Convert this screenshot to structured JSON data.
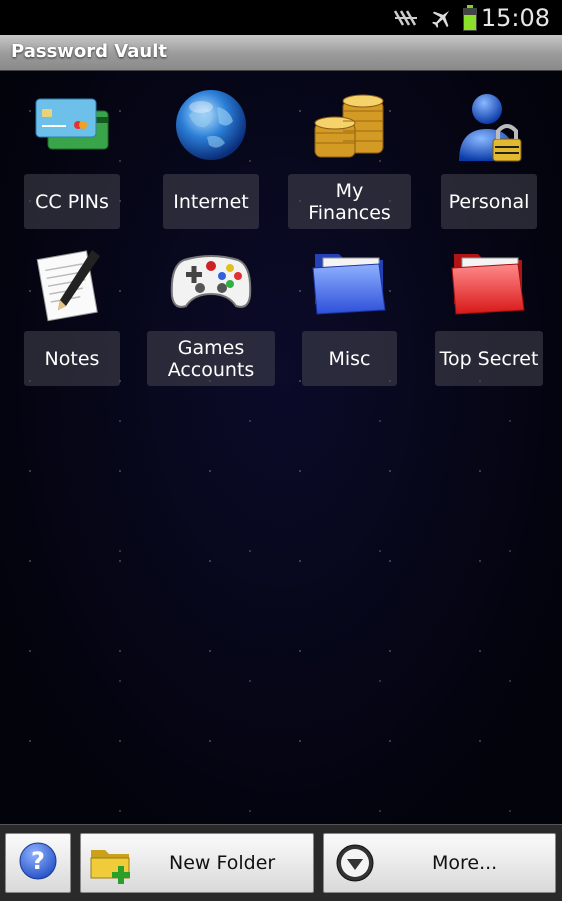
{
  "status_bar": {
    "time": "15:08",
    "icons": [
      "nfc-icon",
      "airplane-mode-icon",
      "battery-icon"
    ]
  },
  "app": {
    "title": "Password Vault"
  },
  "folders": [
    {
      "label": "CC PINs",
      "icon": "credit-cards-icon"
    },
    {
      "label": "Internet",
      "icon": "globe-icon"
    },
    {
      "label": "My Finances",
      "icon": "gold-coins-icon"
    },
    {
      "label": "Personal",
      "icon": "user-lock-icon"
    },
    {
      "label": "Notes",
      "icon": "notepad-pen-icon"
    },
    {
      "label": "Games Accounts",
      "icon": "gamepad-icon"
    },
    {
      "label": "Misc",
      "icon": "blue-folder-icon"
    },
    {
      "label": "Top Secret",
      "icon": "red-folder-icon"
    }
  ],
  "bottom_bar": {
    "help_icon": "help-question-icon",
    "new_folder_label": "New Folder",
    "more_label": "More..."
  },
  "colors": {
    "background": "#05050f",
    "titlebar": "#a6a6a6",
    "label_bg": "#46464f"
  }
}
